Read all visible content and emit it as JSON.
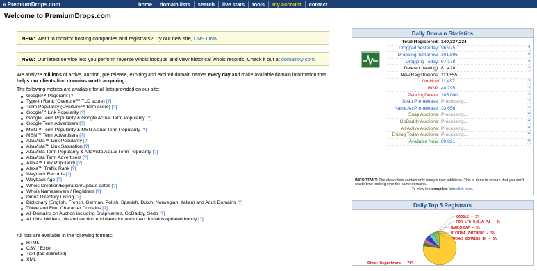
{
  "header": {
    "logo": "» PremiumDrops.com",
    "nav": [
      "home",
      "domain lists",
      "search",
      "live stats",
      "tools",
      "my account",
      "contact"
    ],
    "active_nav": "my account"
  },
  "page_title": "Welcome to PremiumDrops.com",
  "notices": [
    {
      "label": "NEW:",
      "text": "Want to monitor hosting companies and registrars? Try our new site,",
      "link": "DNS.LINK",
      "end": "."
    },
    {
      "label": "NEW:",
      "text": "Our latest service lets you perform reverse whois lookups and view historical whois records. Check it out at",
      "link": "domainIQ.com",
      "end": "."
    }
  ],
  "intro": {
    "p1": "We analyze",
    "b1": "millions",
    "p2": "of active, auction, pre-release, expiring and expired domain names",
    "b2": "every day",
    "p3": "and make available domain information that",
    "b3": "helps our clients find domains worth acquiring.",
    "metrics_intro": "The following metrics are available for all lists provided on our site:",
    "formats_intro": "All lists are available in the following formats:"
  },
  "metrics": [
    {
      "text": "Google™ Pagerank",
      "help": "[?]"
    },
    {
      "text": "Type-in Rank (Overture™ TLD score)",
      "help": "[?]"
    },
    {
      "text": "Term Popularity (Overture™ term score)",
      "help": "[?]"
    },
    {
      "text": "Google™ Link Popularity",
      "help": "[?]"
    },
    {
      "text": "Google Term Popularity & Google Actual Term Popularity",
      "help": "[?]"
    },
    {
      "text": "Google Term Advertisers",
      "help": "[?]"
    },
    {
      "text": "MSN™ Term Popularity & MSN Actual Term Popularity",
      "help": "[?]"
    },
    {
      "text": "MSN™ Term Advertisers",
      "help": "[?]"
    },
    {
      "text": "AltaVista™ Link Popularity",
      "help": "[?]"
    },
    {
      "text": "AltaVista™ Link Saturation",
      "help": "[?]"
    },
    {
      "text": "AltaVista Term Popularity & AltaVista Actual Term Popularity",
      "help": "[?]"
    },
    {
      "text": "AltaVista Term Advertisers",
      "help": "[?]"
    },
    {
      "text": "Alexa™ Link Popularity",
      "help": "[?]"
    },
    {
      "text": "Alexa™ Traffic Rank",
      "help": "[?]"
    },
    {
      "text": "Wayback Records",
      "help": "[?]"
    },
    {
      "text": "Wayback Age",
      "help": "[?]"
    },
    {
      "text": "Whois Creation/Expiration/Update dates",
      "help": "[?]"
    },
    {
      "text": "Whois Nameservers / Registrars",
      "help": "[?]"
    },
    {
      "text": "Dmoz Directory Listing",
      "help": "[?]"
    },
    {
      "text": "Dictionary (English, French, German, Polish, Spanish, Dutch, Norwegian, Italian) and Adult Domains",
      "help": "[?]"
    },
    {
      "text": "Three and Four Character Domains",
      "help": "[?]"
    },
    {
      "text": "All Domains on Auction including SnapNames, GoDaddy, Sedo",
      "help": "[?]"
    },
    {
      "text": "All bids, bidders, bin and auction end dates for auctioned domains updated hourly",
      "help": "[?]"
    }
  ],
  "formats": [
    "HTML",
    "CSV / Excel",
    "Text (tab delimited)",
    "XML"
  ],
  "stats_panel": {
    "title": "Daily Domain Statistics",
    "rows": [
      {
        "label": "Total Registered:",
        "value": "140,337,234",
        "help": "",
        "color": "black",
        "bold": true
      },
      {
        "label": "Dropped Yesterday:",
        "value": "96,975",
        "help": "[?]",
        "color": "blue"
      },
      {
        "label": "Dropping Tomorrow:",
        "value": "101,896",
        "help": "[?]",
        "color": "blue"
      },
      {
        "label": "Dropping Today:",
        "value": "97,178",
        "help": "[?]",
        "color": "blue"
      },
      {
        "label": "Deleted (tasting):",
        "value": "81,428",
        "help": "[?]",
        "color": "black"
      },
      {
        "label": "New Registrations:",
        "value": "113,555",
        "help": "",
        "color": "black"
      },
      {
        "label": "On-Hold",
        "value": "11,497",
        "help": "[?]",
        "color": "red"
      },
      {
        "label": "RGP:",
        "value": "40,795",
        "help": "[?]",
        "color": "red"
      },
      {
        "label": "PendingDelete:",
        "value": "105,000",
        "help": "[?]",
        "color": "red"
      },
      {
        "label": "Snap Pre-release:",
        "value": "Processing...",
        "help": "[?]",
        "color": "blue",
        "gray": true
      },
      {
        "label": "NameJet Pre-release:",
        "value": "33,656",
        "help": "[?]",
        "color": "blue"
      },
      {
        "label": "Snap Auctions:",
        "value": "Processing...",
        "help": "[?]",
        "color": "olive",
        "gray": true
      },
      {
        "label": "GoDaddy Auctions:",
        "value": "Processing...",
        "help": "[?]",
        "color": "olive",
        "gray": true
      },
      {
        "label": "All Active Auctions:",
        "value": "Processing...",
        "help": "[?]",
        "color": "olive",
        "gray": true
      },
      {
        "label": "Ending Today Auctions:",
        "value": "Processing...",
        "help": "[?]",
        "color": "olive",
        "gray": true
      },
      {
        "label": "Available Now:",
        "value": "89,821",
        "help": "[?]",
        "color": "green"
      }
    ],
    "note_label": "IMPORTANT:",
    "note": "The above lists contain only today's new additions. This is done to ensure that you don't waste time looking over the same domains.",
    "note2": "To view the",
    "note2_bold": "complete",
    "note2_b": "lists",
    "note2_link": "click here",
    "note2_end": "."
  },
  "top5_panel": {
    "title": "Daily Top 5 Registrars",
    "chart_data": {
      "type": "pie",
      "slices": [
        {
          "label": "GOOGLE - 3%",
          "value": 3,
          "color": "#2c8a2c"
        },
        {
          "label": "PDR LTD D/B/A PU - 4%",
          "value": 4,
          "color": "#cc6699"
        },
        {
          "label": "NAMECHEAP - 5%",
          "value": 5,
          "color": "#3333cc"
        },
        {
          "label": "HICHINA ZHICHENG - 5%",
          "value": 5,
          "color": "#66cccc"
        },
        {
          "label": "TUCOWS DOMAINS IN - 5%",
          "value": 5,
          "color": "#99cc33"
        },
        {
          "label": "Other Registrars - 78%",
          "value": 78,
          "color": "#ffcc33"
        }
      ]
    }
  }
}
